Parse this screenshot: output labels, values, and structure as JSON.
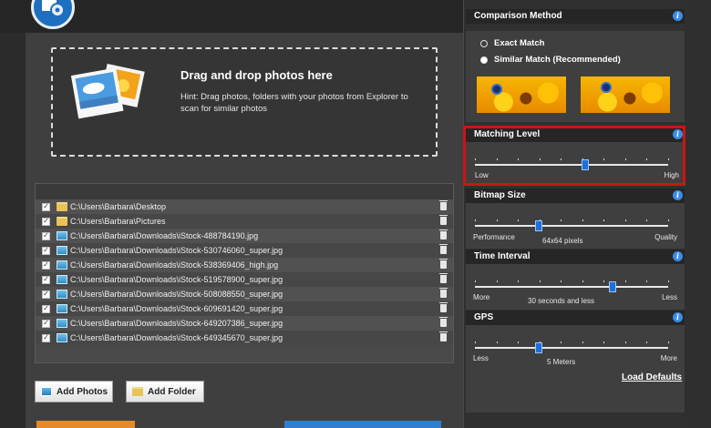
{
  "drop_zone": {
    "title": "Drag and drop photos here",
    "hint": "Hint: Drag photos, folders with your photos from Explorer to scan for similar photos"
  },
  "file_list": {
    "rows": [
      {
        "path": "C:\\Users\\Barbara\\Desktop",
        "type": "folder",
        "checked": true
      },
      {
        "path": "C:\\Users\\Barbara\\Pictures",
        "type": "folder",
        "checked": true
      },
      {
        "path": "C:\\Users\\Barbara\\Downloads\\iStock-488784190.jpg",
        "type": "image",
        "checked": true
      },
      {
        "path": "C:\\Users\\Barbara\\Downloads\\iStock-530746060_super.jpg",
        "type": "image",
        "checked": true
      },
      {
        "path": "C:\\Users\\Barbara\\Downloads\\iStock-538369406_high.jpg",
        "type": "image",
        "checked": true
      },
      {
        "path": "C:\\Users\\Barbara\\Downloads\\iStock-519578900_super.jpg",
        "type": "image",
        "checked": true
      },
      {
        "path": "C:\\Users\\Barbara\\Downloads\\iStock-508088550_super.jpg",
        "type": "image",
        "checked": true
      },
      {
        "path": "C:\\Users\\Barbara\\Downloads\\iStock-609691420_super.jpg",
        "type": "image",
        "checked": true
      },
      {
        "path": "C:\\Users\\Barbara\\Downloads\\iStock-649207386_super.jpg",
        "type": "image",
        "checked": true
      },
      {
        "path": "C:\\Users\\Barbara\\Downloads\\iStock-649345670_super.jpg",
        "type": "image",
        "checked": true
      }
    ]
  },
  "buttons": {
    "add_photos": "Add Photos",
    "add_folder": "Add Folder"
  },
  "settings": {
    "comparison_method": {
      "title": "Comparison Method",
      "options": [
        "Exact Match",
        "Similar Match (Recommended)"
      ],
      "selected_index": 1
    },
    "matching_level": {
      "title": "Matching Level",
      "low": "Low",
      "high": "High",
      "value_fraction": 0.57
    },
    "bitmap_size": {
      "title": "Bitmap Size",
      "left": "Performance",
      "right": "Quality",
      "value": "64x64 pixels",
      "value_fraction": 0.33
    },
    "time_interval": {
      "title": "Time Interval",
      "left": "More",
      "right": "Less",
      "value": "30 seconds and less",
      "value_fraction": 0.71
    },
    "gps": {
      "title": "GPS",
      "left": "Less",
      "right": "More",
      "value": "5 Meters",
      "value_fraction": 0.33
    },
    "load_defaults": "Load Defaults"
  },
  "colors": {
    "accent_blue": "#1e6fd8",
    "highlight_red": "#cc1515",
    "info_blue": "#3b8ee6"
  },
  "icons": {
    "app_logo": "gear-photo-icon",
    "drop_zone": "photos-stack-icon",
    "folder_row": "folder-icon",
    "image_row": "image-file-icon",
    "row_action": "trash-icon",
    "section_help": "info-icon"
  }
}
